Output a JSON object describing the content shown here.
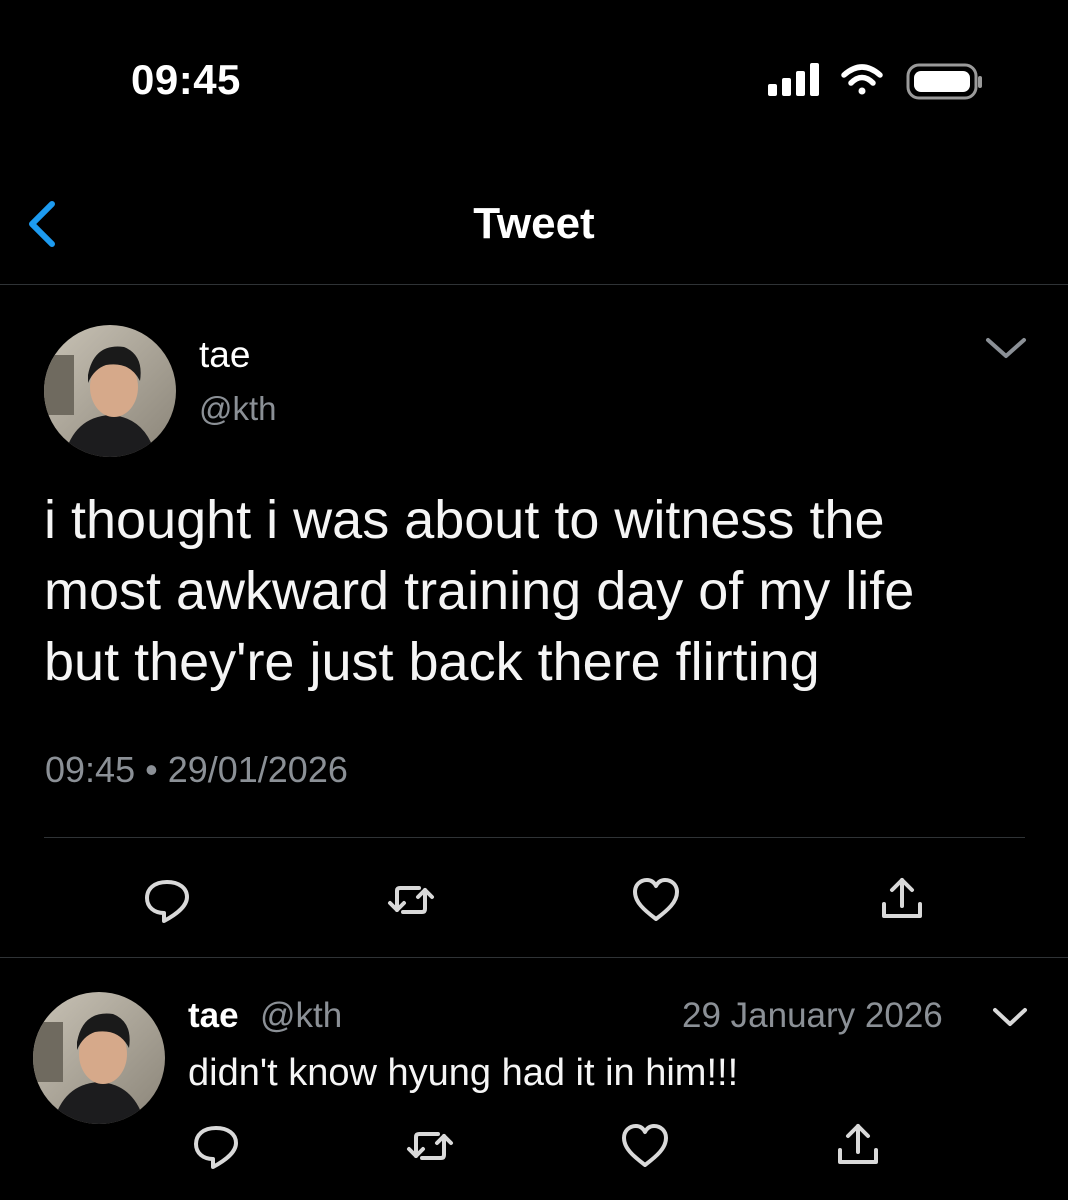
{
  "status_bar": {
    "time": "09:45"
  },
  "nav": {
    "title": "Tweet",
    "back_icon": "chevron-left-icon"
  },
  "colors": {
    "background": "#000000",
    "accent": "#1d9bf0",
    "secondary_text": "#8b9096",
    "divider": "#2f3336"
  },
  "tweet": {
    "display_name": "tae",
    "handle": "@kth",
    "text": "i thought i was about to witness the most awkward training day of my life but they're just back there flirting",
    "text_lines": [
      "i thought i was about to witness the",
      "most awkward training day of my life",
      "but they're just back there flirting"
    ],
    "timestamp": "09:45 • 29/01/2026",
    "actions": [
      "reply-icon",
      "retweet-icon",
      "like-icon",
      "share-icon"
    ]
  },
  "reply": {
    "display_name": "tae",
    "handle": "@kth",
    "date": "29 January 2026",
    "text": "didn't know hyung had it in him!!!",
    "actions": [
      "reply-icon",
      "retweet-icon",
      "like-icon",
      "share-icon"
    ]
  }
}
